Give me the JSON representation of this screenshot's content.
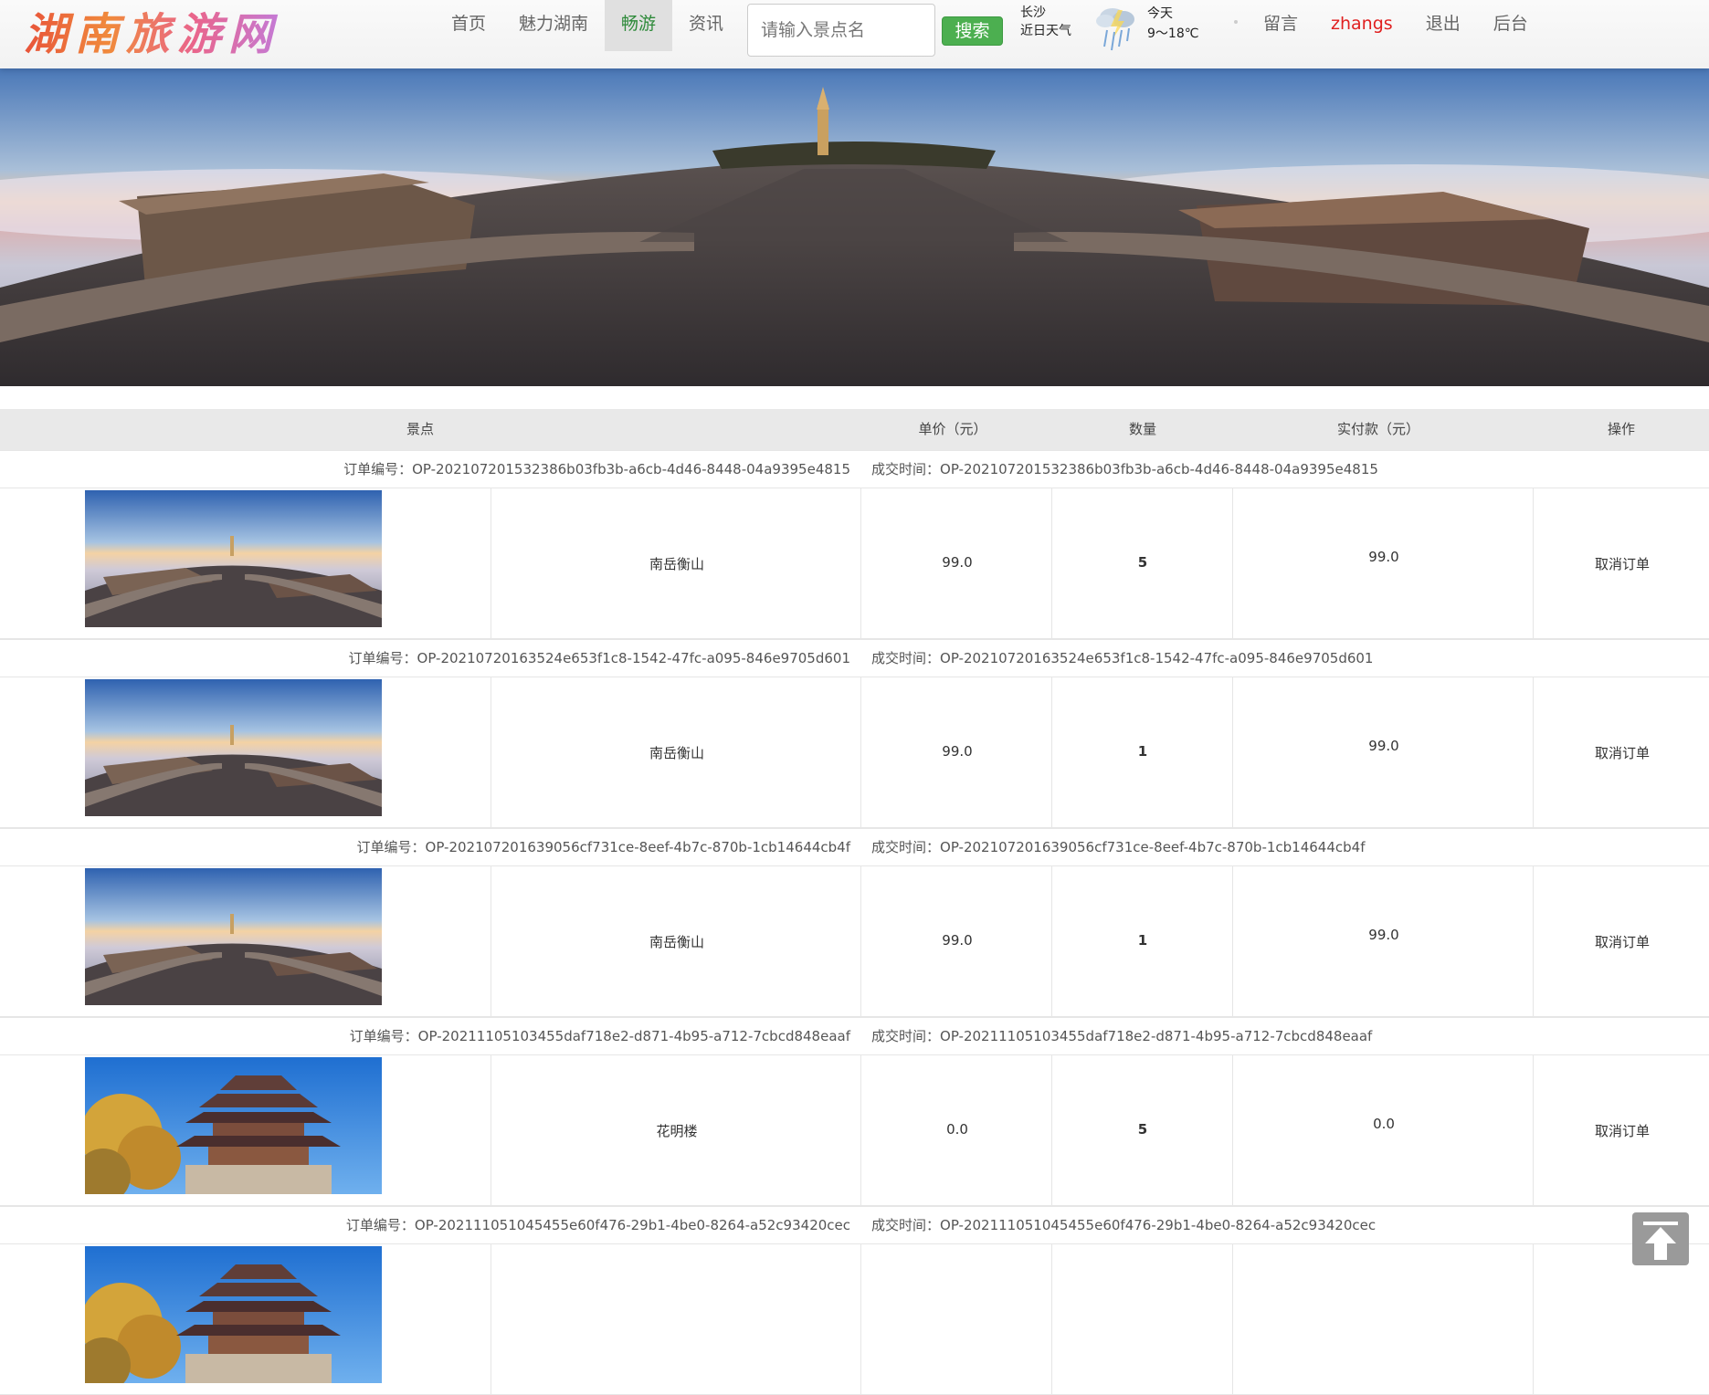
{
  "header": {
    "logo": "湖南旅游网",
    "nav": [
      {
        "label": "首页",
        "active": false
      },
      {
        "label": "魅力湖南",
        "active": false
      },
      {
        "label": "畅游",
        "active": true
      },
      {
        "label": "资讯",
        "active": false
      }
    ],
    "search": {
      "placeholder": "请输入景点名",
      "button": "搜索"
    },
    "weather": {
      "city": "长沙",
      "city_caption": "近日天气",
      "icon": "rain-cloud-icon",
      "day": "今天",
      "temp": "9～18℃"
    },
    "right_links": {
      "message": "留言",
      "user": "zhangs",
      "logout": "退出",
      "admin": "后台"
    }
  },
  "banner": {
    "slide_count": 4,
    "active_slide": 3
  },
  "table": {
    "headers": {
      "spot": "景点",
      "price": "单价（元）",
      "qty": "数量",
      "paid": "实付款（元）",
      "action": "操作"
    },
    "order_no_label": "订单编号：",
    "time_label": "成交时间：",
    "orders": [
      {
        "order_no": "OP-20210720153238​6b03fb3b-a6cb-4d46-8448-04a9395e4815",
        "time": "OP-202107201532386b03fb3b-a6cb-4d46-8448-04a9395e4815",
        "spot": "南岳衡山",
        "price": "99.0",
        "qty": "5",
        "paid": "99.0",
        "action": "取消订单",
        "image": "hengshan"
      },
      {
        "order_no": "OP-20210720163524e653f1c8-1542-47fc-a095-846e9705d601",
        "time": "OP-20210720163524e653f1c8-1542-47fc-a095-846e9705d601",
        "spot": "南岳衡山",
        "price": "99.0",
        "qty": "1",
        "paid": "99.0",
        "action": "取消订单",
        "image": "hengshan"
      },
      {
        "order_no": "OP-202107201639056cf731ce-8eef-4b7c-870b-1cb14644cb4f",
        "time": "OP-202107201639056cf731ce-8eef-4b7c-870b-1cb14644cb4f",
        "spot": "南岳衡山",
        "price": "99.0",
        "qty": "1",
        "paid": "99.0",
        "action": "取消订单",
        "image": "hengshan"
      },
      {
        "order_no": "OP-20211105103455daf718e2-d871-4b95-a712-7cbcd848eaaf",
        "time": "OP-20211105103455daf718e2-d871-4b95-a712-7cbcd848eaaf",
        "spot": "花明楼",
        "price": "0.0",
        "qty": "5",
        "paid": "0.0",
        "action": "取消订单",
        "image": "huaminglou"
      },
      {
        "order_no": "OP-202111051045455e60f476-29b1-4be0-8264-a52c93420cec",
        "time": "OP-202111051045455e60f476-29b1-4be0-8264-a52c93420cec",
        "spot": "",
        "price": "",
        "qty": "",
        "paid": "",
        "action": "",
        "image": "huaminglou"
      }
    ]
  },
  "scroll_top": {
    "icon": "arrow-up-icon"
  }
}
